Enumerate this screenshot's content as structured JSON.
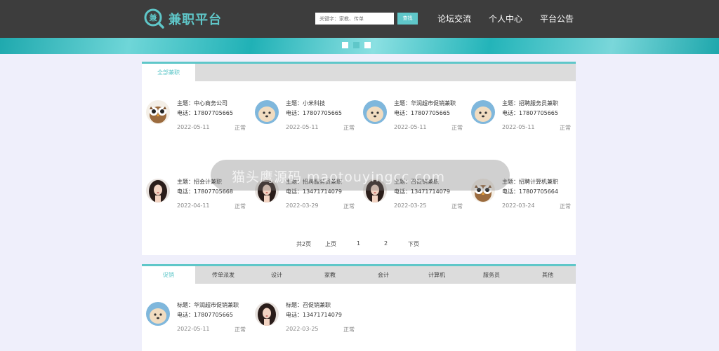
{
  "header": {
    "logo_char": "兼",
    "logo_text": "兼职平台",
    "search_placeholder": "关键字：家教、传单",
    "search_button": "查找",
    "nav": [
      "论坛交流",
      "个人中心",
      "平台公告"
    ]
  },
  "colors": {
    "accent": "#5fc7c9",
    "header_bg": "#3d3d3d",
    "page_bg": "#efeffb"
  },
  "section1": {
    "tab": "全部兼职",
    "cards": [
      {
        "title": "主题：中心商务公司",
        "phone": "电话：17807705665",
        "date": "2022-05-11",
        "status": "正常",
        "avatar": "owl"
      },
      {
        "title": "主题：小米科技",
        "phone": "电话：17807705665",
        "date": "2022-05-11",
        "status": "正常",
        "avatar": "dog"
      },
      {
        "title": "主题：华润超市促销兼职",
        "phone": "电话：17807705665",
        "date": "2022-05-11",
        "status": "正常",
        "avatar": "dog"
      },
      {
        "title": "主题：招聘服务员兼职",
        "phone": "电话：17807705665",
        "date": "2022-05-11",
        "status": "正常",
        "avatar": "dog"
      },
      {
        "title": "主题：招会计兼职",
        "phone": "电话：17807705668",
        "date": "2022-04-11",
        "status": "正常",
        "avatar": "woman"
      },
      {
        "title": "主题：招聘服务员兼职",
        "phone": "电话：13471714079",
        "date": "2022-03-29",
        "status": "正常",
        "avatar": "woman"
      },
      {
        "title": "主题：召促销兼职",
        "phone": "电话：13471714079",
        "date": "2022-03-25",
        "status": "正常",
        "avatar": "woman"
      },
      {
        "title": "主题：招聘计算机兼职",
        "phone": "电话：17807705664",
        "date": "2022-03-24",
        "status": "正常",
        "avatar": "owl"
      }
    ],
    "pager": {
      "total": "共2页",
      "prev": "上页",
      "pages": [
        "1",
        "2"
      ],
      "next": "下页"
    }
  },
  "section2": {
    "tabs": [
      "促销",
      "传单派发",
      "设计",
      "家教",
      "会计",
      "计算机",
      "服务员",
      "其他"
    ],
    "cards": [
      {
        "title": "标题：华润超市促销兼职",
        "phone": "电话：17807705665",
        "date": "2022-05-11",
        "status": "正常",
        "avatar": "dog"
      },
      {
        "title": "标题：召促销兼职",
        "phone": "电话：13471714079",
        "date": "2022-03-25",
        "status": "正常",
        "avatar": "woman"
      }
    ]
  },
  "watermark": {
    "text": "猫头鹰源码 maotouyingcc.com"
  }
}
